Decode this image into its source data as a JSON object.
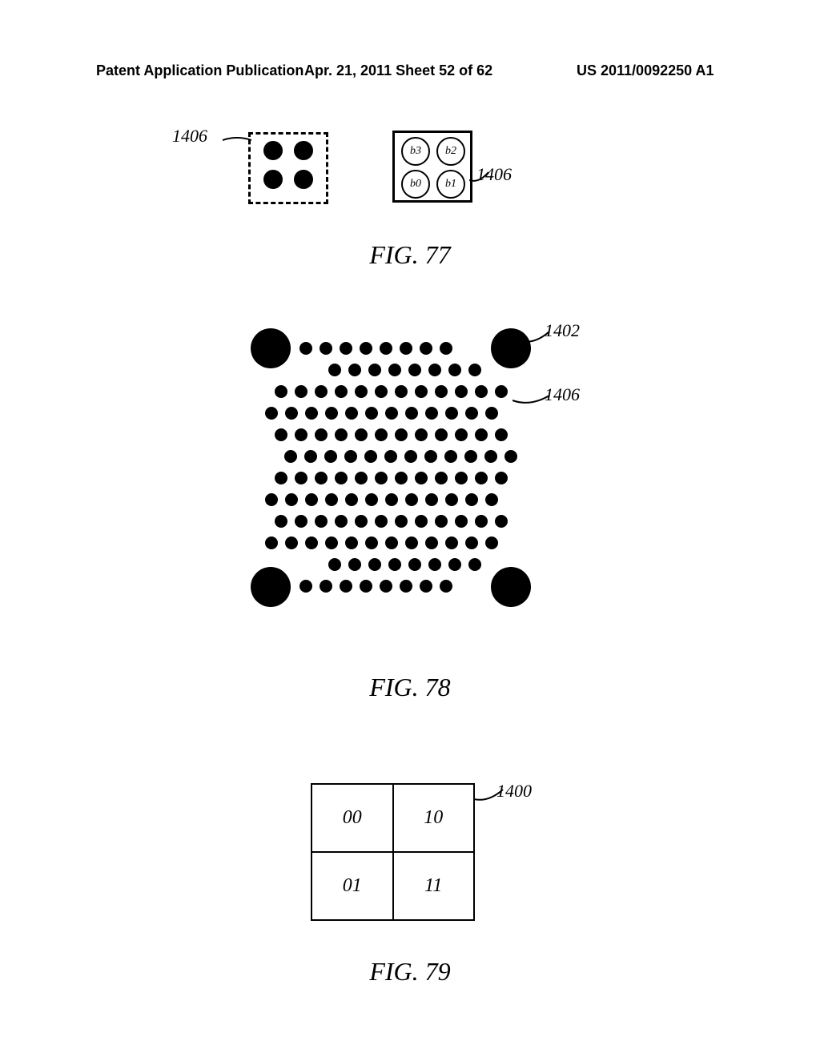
{
  "header": {
    "left": "Patent Application Publication",
    "center": "Apr. 21, 2011  Sheet 52 of 62",
    "right": "US 2011/0092250 A1"
  },
  "fig77": {
    "caption": "FIG. 77",
    "label_left": "1406",
    "label_right": "1406",
    "circle_tl": "b3",
    "circle_tr": "b2",
    "circle_bl": "b0",
    "circle_br": "b1"
  },
  "fig78": {
    "caption": "FIG. 78",
    "label_1402": "1402",
    "label_1406": "1406"
  },
  "fig79": {
    "caption": "FIG. 79",
    "label_1400": "1400",
    "cell_00": "00",
    "cell_10": "10",
    "cell_01": "01",
    "cell_11": "11"
  }
}
